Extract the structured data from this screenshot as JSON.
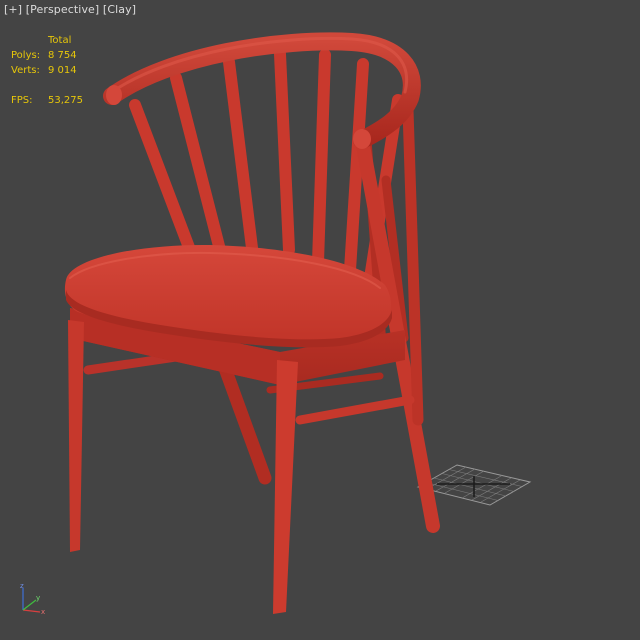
{
  "viewport": {
    "label": {
      "plus": "[+]",
      "view": "[Perspective]",
      "shading": "[Clay]"
    },
    "stats": {
      "header": "Total",
      "polys_label": "Polys:",
      "polys_value": "8 754",
      "verts_label": "Verts:",
      "verts_value": "9 014",
      "fps_label": "FPS:",
      "fps_value": "53,275"
    },
    "colors": {
      "background": "#444444",
      "clay": "#c83a2e",
      "stats_text": "#e6c60a",
      "label_text": "#dcdcdc"
    },
    "icons": {
      "axis_gizmo": "xyz-axis-gizmo-icon",
      "light_object": "grid-light-plane-icon"
    }
  }
}
